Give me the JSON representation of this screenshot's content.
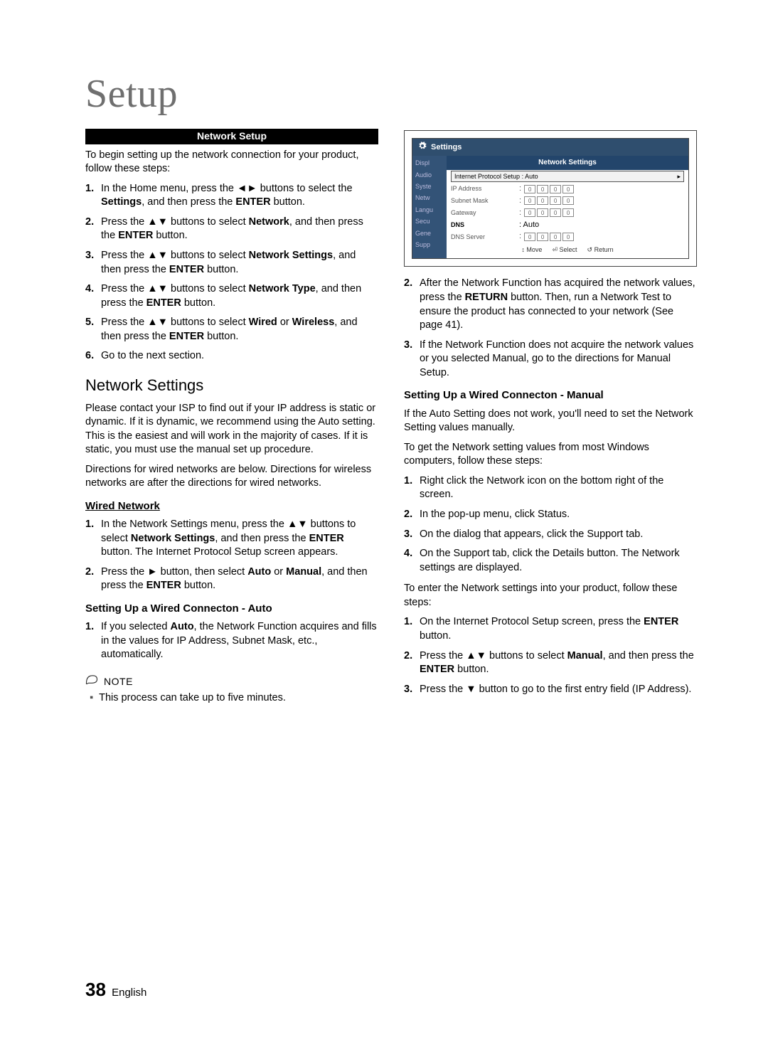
{
  "pageTitle": "Setup",
  "barLabel": "Network Setup",
  "left": {
    "intro": "To begin setting up the network connection for your product, follow these steps:",
    "steps": {
      "s1a": "In the Home menu, press the ",
      "s1b": " buttons to select the ",
      "s1bold1": "Settings",
      "s1c": ", and then press the ",
      "s1bold2": "ENTER",
      "s1d": " button.",
      "s2a": "Press the ",
      "s2b": " buttons to select ",
      "s2bold1": "Network",
      "s2c": ", and then press the ",
      "s2bold2": "ENTER",
      "s2d": " button.",
      "s3a": "Press the ",
      "s3b": " buttons to select ",
      "s3bold1": "Network Settings",
      "s3c": ", and then press the ",
      "s3bold2": "ENTER",
      "s3d": " button.",
      "s4a": "Press the ",
      "s4b": " buttons to select ",
      "s4bold1": "Network Type",
      "s4c": ", and then press the ",
      "s4bold2": "ENTER",
      "s4d": " button.",
      "s5a": "Press the ",
      "s5b": " buttons to select ",
      "s5bold1": "Wired",
      "s5or": " or ",
      "s5bold2": "Wireless",
      "s5c": ", and then press the ",
      "s5bold3": "ENTER",
      "s5d": " button.",
      "s6": "Go to the next section."
    },
    "h2": "Network Settings",
    "p1": "Please contact your ISP to find out if your IP address is static or dynamic. If it is dynamic, we recommend using the Auto setting. This is the easiest and will work in the majority of cases. If it is static, you must use the manual set up procedure.",
    "p2": "Directions for wired networks are below. Directions for wireless networks are after the directions for wired networks.",
    "h3": "Wired Network",
    "wired": {
      "w1a": "In the Network Settings menu, press the ",
      "w1b": " buttons to select ",
      "w1bold1": "Network Settings",
      "w1c": ", and then press the ",
      "w1bold2": "ENTER",
      "w1d": " button. The Internet Protocol Setup screen appears.",
      "w2a": "Press the ",
      "w2b": " button, then select ",
      "w2bold1": "Auto",
      "w2or": " or ",
      "w2bold2": "Manual",
      "w2c": ", and then press the ",
      "w2bold3": "ENTER",
      "w2d": " button."
    },
    "h4": "Setting Up a Wired Connecton - Auto",
    "auto1a": "If you selected ",
    "auto1bold": "Auto",
    "auto1b": ", the Network Function acquires and fills in the values for IP Address, Subnet Mask, etc., automatically.",
    "noteLabel": "NOTE",
    "noteText": "This process can take up to five minutes."
  },
  "right": {
    "settingsPanel": {
      "top": "Settings",
      "sideTabs": [
        "Displ",
        "Audio",
        "Syste",
        "Netw",
        "Langu",
        "Secu",
        "Gene",
        "Supp"
      ],
      "dlgTitle": "Network Settings",
      "ipProtoLabel": "Internet Protocol Setup",
      "ipProtoVal": ": Auto",
      "rows": [
        {
          "label": "IP Address",
          "vals": [
            "0",
            "0",
            "0",
            "0"
          ]
        },
        {
          "label": "Subnet Mask",
          "vals": [
            "0",
            "0",
            "0",
            "0"
          ]
        },
        {
          "label": "Gateway",
          "vals": [
            "0",
            "0",
            "0",
            "0"
          ]
        }
      ],
      "dnsLabel": "DNS",
      "dnsVal": ": Auto",
      "dnsServer": {
        "label": "DNS Server",
        "vals": [
          "0",
          "0",
          "0",
          "0"
        ]
      },
      "foot": {
        "move": "Move",
        "select": "Select",
        "return": "Return"
      }
    },
    "afterSteps": {
      "a2a": "After the Network Function has acquired the network values, press the ",
      "a2bold": "RETURN",
      "a2b": " button. Then, run a Network Test to ensure the product has connected to your network (See page 41).",
      "a3": "If the Network Function does not acquire the network values or you selected Manual, go to the directions for Manual Setup."
    },
    "h4manual": "Setting Up a Wired Connecton - Manual",
    "mp1": "If the Auto Setting does not work, you'll need to set the Network Setting values manually.",
    "mp2": "To get the Network setting values from most Windows computers, follow these steps:",
    "msteps": {
      "m1": "Right click the Network icon on the bottom right of the screen.",
      "m2": "In the pop-up menu, click Status.",
      "m3": "On the dialog that appears, click the Support tab.",
      "m4": "On the Support tab, click the Details button. The Network settings are displayed."
    },
    "mp3": "To enter the Network settings into your product, follow these steps:",
    "msteps2": {
      "n1a": "On the Internet Protocol Setup screen, press the ",
      "n1bold": "ENTER",
      "n1b": " button.",
      "n2a": "Press the ",
      "n2b": " buttons to select ",
      "n2bold1": "Manual",
      "n2c": ", and then press the ",
      "n2bold2": "ENTER",
      "n2d": " button.",
      "n3a": "Press the ",
      "n3b": " button to go to the first entry field (IP Address)."
    }
  },
  "glyphs": {
    "lr": "◄►",
    "ud": "▲▼",
    "r": "►",
    "d": "▼",
    "updown": "▲▼",
    "tri_r": "▸",
    "enter": "⏎",
    "ret": "↺",
    "updownMove": "↕"
  },
  "footer": {
    "page": "38",
    "lang": "English"
  }
}
